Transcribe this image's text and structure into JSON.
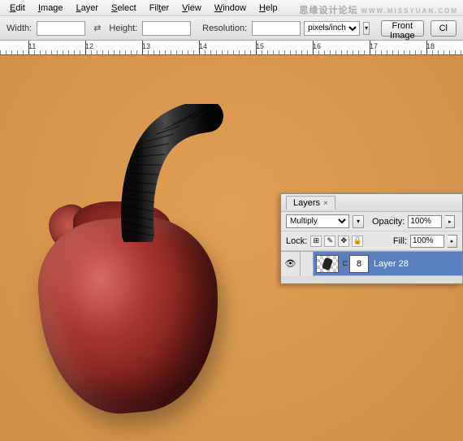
{
  "menubar": {
    "items": [
      "Edit",
      "Image",
      "Layer",
      "Select",
      "Filter",
      "View",
      "Window",
      "Help"
    ]
  },
  "options": {
    "width_label": "Width:",
    "width_value": "",
    "height_label": "Height:",
    "height_value": "",
    "resolution_label": "Resolution:",
    "resolution_value": "",
    "units": "pixels/inch",
    "front_image": "Front Image",
    "clear": "Cl"
  },
  "ruler": {
    "ticks": [
      "11",
      "12",
      "13",
      "14",
      "15",
      "16",
      "17",
      "18"
    ]
  },
  "watermark": {
    "main": "思缘设计论坛",
    "sub": "WWW.MISSYUAN.COM"
  },
  "layers": {
    "tab": "Layers",
    "blend_mode": "Multiply",
    "opacity_label": "Opacity:",
    "opacity_value": "100%",
    "lock_label": "Lock:",
    "fill_label": "Fill:",
    "fill_value": "100%",
    "layer_name": "Layer 28",
    "mask_label": "8"
  },
  "icons": {
    "swap": "⇄",
    "dropdown": "▾",
    "close": "×",
    "eye": "👁",
    "slider": "▸",
    "lock_trans": "⊞",
    "lock_paint": "✎",
    "lock_move": "✥",
    "lock_all": "🔒",
    "chain": "⊏"
  }
}
